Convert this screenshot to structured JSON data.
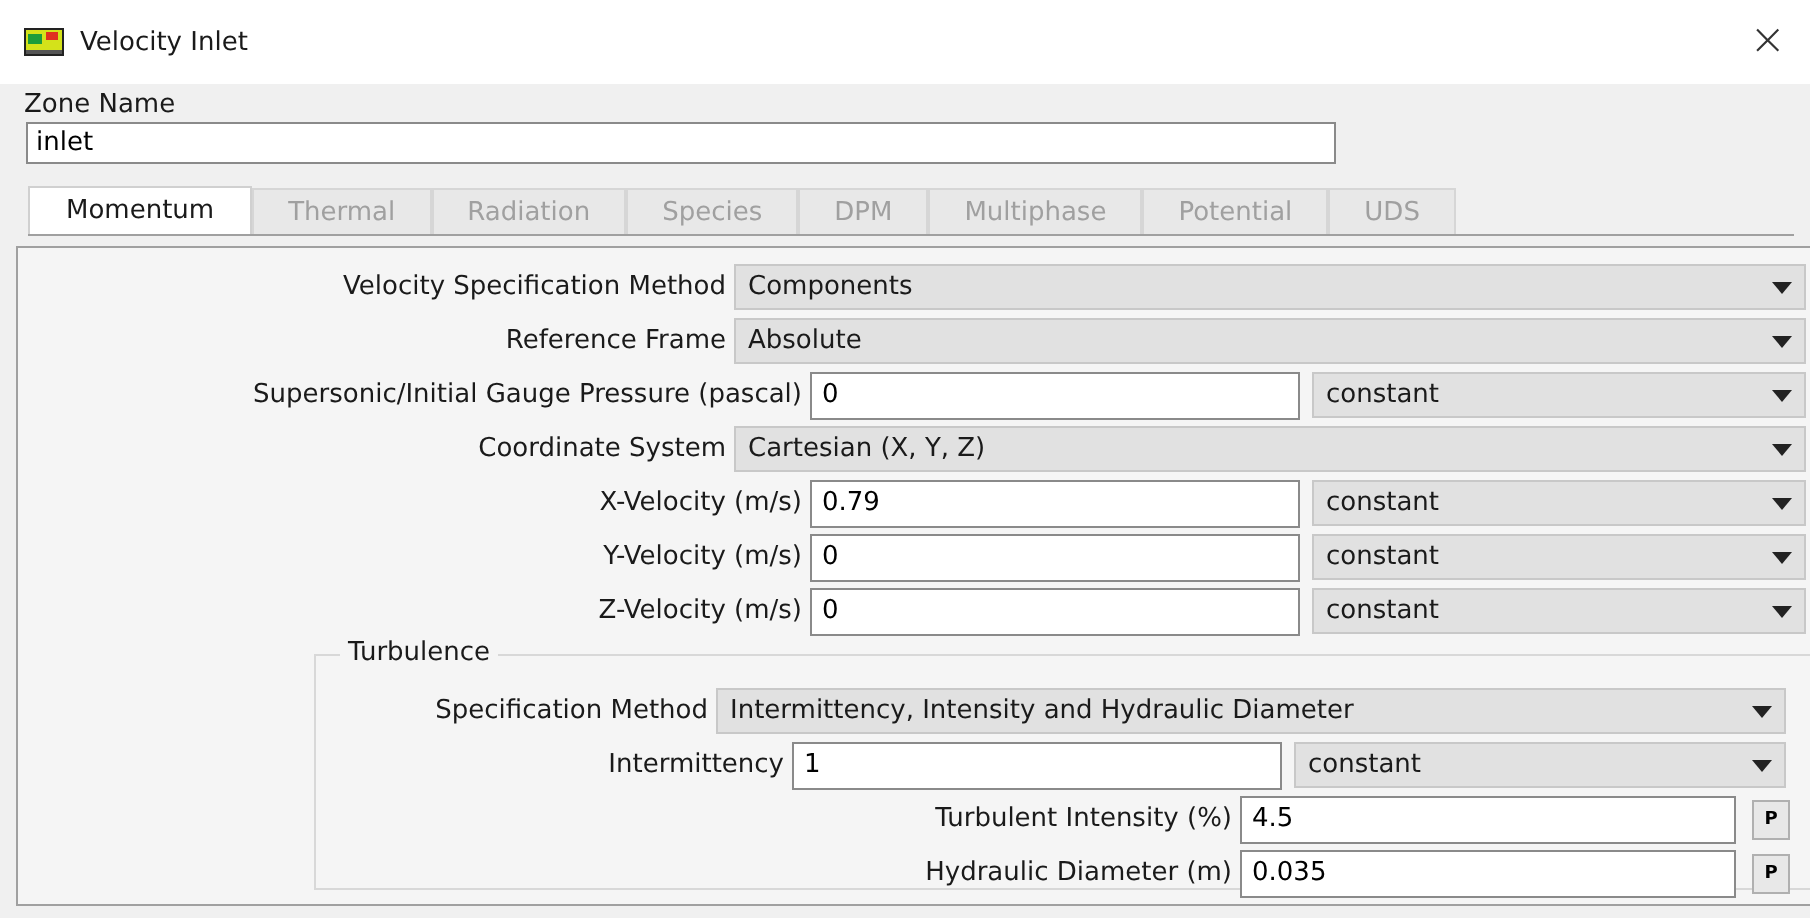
{
  "window": {
    "title": "Velocity Inlet",
    "close": "×"
  },
  "zone": {
    "label": "Zone Name",
    "value": "inlet"
  },
  "tabs": [
    {
      "label": "Momentum",
      "selected": true,
      "disabled": false
    },
    {
      "label": "Thermal",
      "selected": false,
      "disabled": true
    },
    {
      "label": "Radiation",
      "selected": false,
      "disabled": true
    },
    {
      "label": "Species",
      "selected": false,
      "disabled": true
    },
    {
      "label": "DPM",
      "selected": false,
      "disabled": true
    },
    {
      "label": "Multiphase",
      "selected": false,
      "disabled": true
    },
    {
      "label": "Potential",
      "selected": false,
      "disabled": true
    },
    {
      "label": "UDS",
      "selected": false,
      "disabled": true
    }
  ],
  "fields": [
    {
      "kind": "dropdown",
      "label": "Velocity Specification Method",
      "value": "Components"
    },
    {
      "kind": "dropdown",
      "label": "Reference Frame",
      "value": "Absolute"
    },
    {
      "kind": "input",
      "label": "Supersonic/Initial Gauge Pressure (pascal)",
      "value": "0",
      "profile": "constant"
    },
    {
      "kind": "dropdown",
      "label": "Coordinate System",
      "value": "Cartesian (X, Y, Z)"
    },
    {
      "kind": "input",
      "label": "X-Velocity (m/s)",
      "value": "0.79",
      "profile": "constant"
    },
    {
      "kind": "input",
      "label": "Y-Velocity (m/s)",
      "value": "0",
      "profile": "constant"
    },
    {
      "kind": "input",
      "label": "Z-Velocity (m/s)",
      "value": "0",
      "profile": "constant"
    }
  ],
  "turbulence": {
    "title": "Turbulence",
    "fields": [
      {
        "kind": "dropdown",
        "label": "Specification Method",
        "value": "Intermittency, Intensity and Hydraulic Diameter"
      },
      {
        "kind": "input",
        "label": "Intermittency",
        "value": "1",
        "profile": "constant"
      },
      {
        "kind": "param",
        "label": "Turbulent Intensity (%)",
        "value": "4.5",
        "button": "P"
      },
      {
        "kind": "param",
        "label": "Hydraulic Diameter (m)",
        "value": "0.035",
        "button": "P"
      }
    ]
  }
}
